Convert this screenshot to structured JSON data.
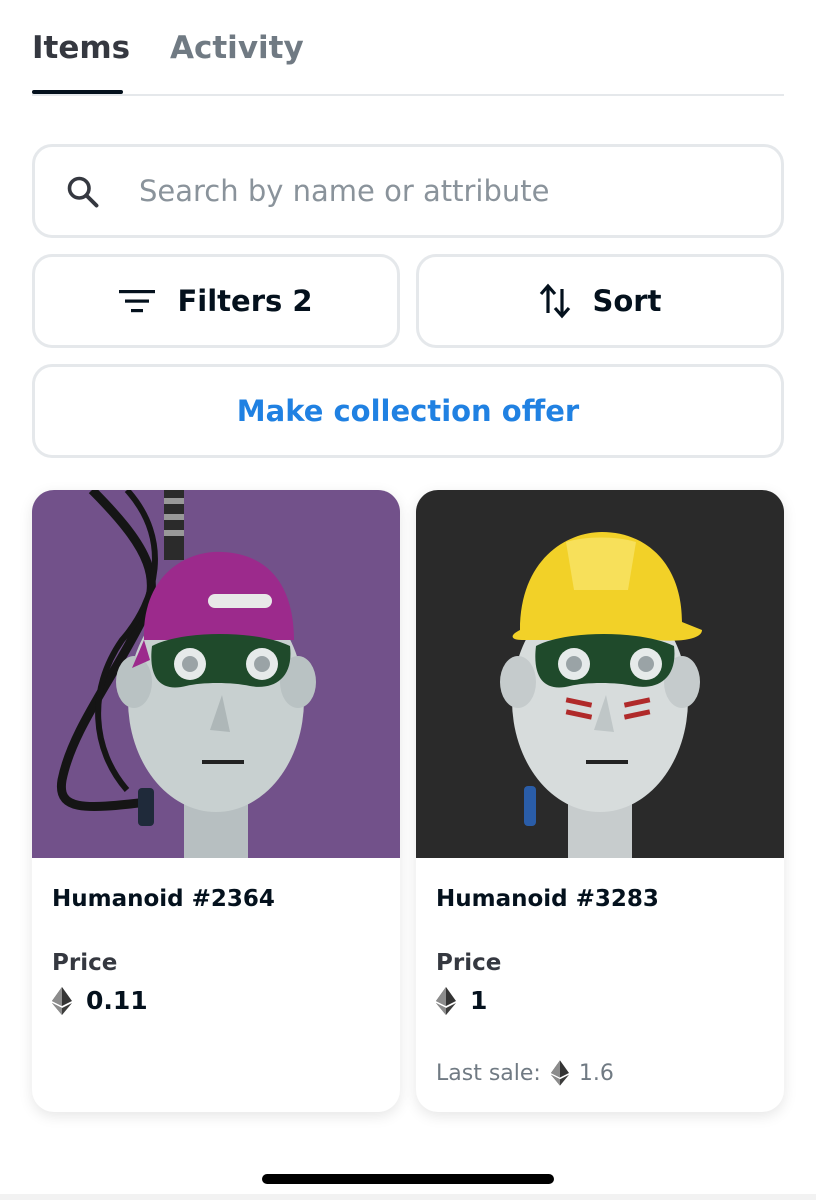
{
  "tabs": [
    {
      "label": "Items",
      "active": true
    },
    {
      "label": "Activity",
      "active": false
    }
  ],
  "search": {
    "placeholder": "Search by name or attribute",
    "value": ""
  },
  "filters_button": {
    "label": "Filters 2"
  },
  "sort_button": {
    "label": "Sort"
  },
  "offer_button": {
    "label": "Make collection offer"
  },
  "items": [
    {
      "name": "Humanoid #2364",
      "price_label": "Price",
      "price": "0.11",
      "background": "#72518a",
      "hat": "cap",
      "hat_color": "#9c2a8c"
    },
    {
      "name": "Humanoid #3283",
      "price_label": "Price",
      "price": "1",
      "last_sale_label": "Last sale:",
      "last_sale": "1.6",
      "background": "#2a2a2a",
      "hat": "hard-hat",
      "hat_color": "#f2d128"
    }
  ],
  "colors": {
    "accent": "#2081e2",
    "text": "#04111d",
    "muted": "#707a83",
    "border": "#e5e8eb"
  },
  "icons": [
    "search-icon",
    "filter-icon",
    "sort-icon",
    "ethereum-icon"
  ]
}
